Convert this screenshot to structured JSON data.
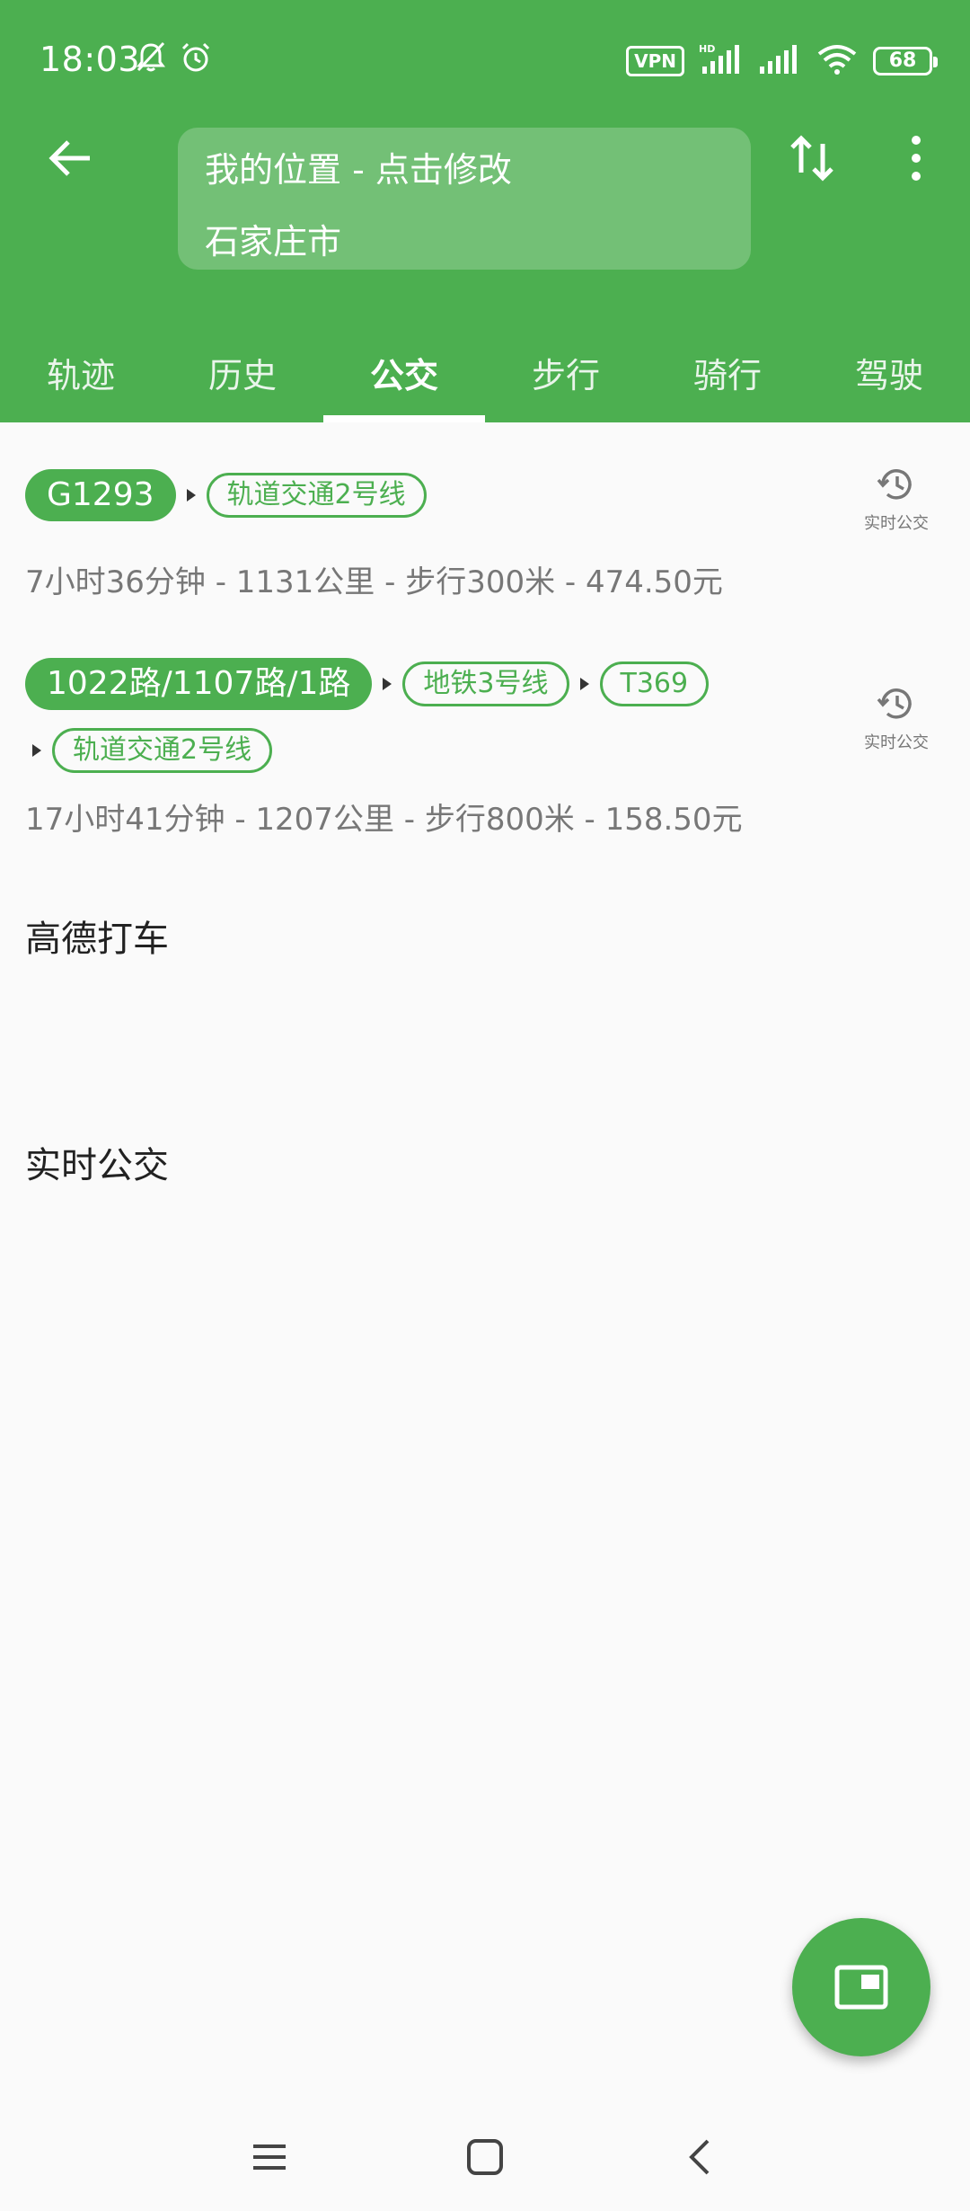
{
  "status_bar": {
    "time": "18:03",
    "vpn": "VPN",
    "battery": "68"
  },
  "header": {
    "from": "我的位置 - 点击修改",
    "to": "石家庄市"
  },
  "tabs": [
    {
      "label": "轨迹"
    },
    {
      "label": "历史"
    },
    {
      "label": "公交"
    },
    {
      "label": "步行"
    },
    {
      "label": "骑行"
    },
    {
      "label": "驾驶"
    }
  ],
  "routes": [
    {
      "main_line": "G1293",
      "segments": [
        "轨道交通2号线"
      ],
      "summary": "7小时36分钟 - 1131公里 - 步行300米 - 474.50元",
      "realtime_label": "实时公交"
    },
    {
      "main_line": "1022路/1107路/1路",
      "segments": [
        "地铁3号线",
        "T369",
        "轨道交通2号线"
      ],
      "summary": "17小时41分钟 - 1207公里 - 步行800米 - 158.50元",
      "realtime_label": "实时公交"
    }
  ],
  "sections": {
    "taxi": "高德打车",
    "realtime": "实时公交"
  },
  "colors": {
    "accent": "#4caf50",
    "background": "#fafafa",
    "muted_text": "#777777"
  }
}
